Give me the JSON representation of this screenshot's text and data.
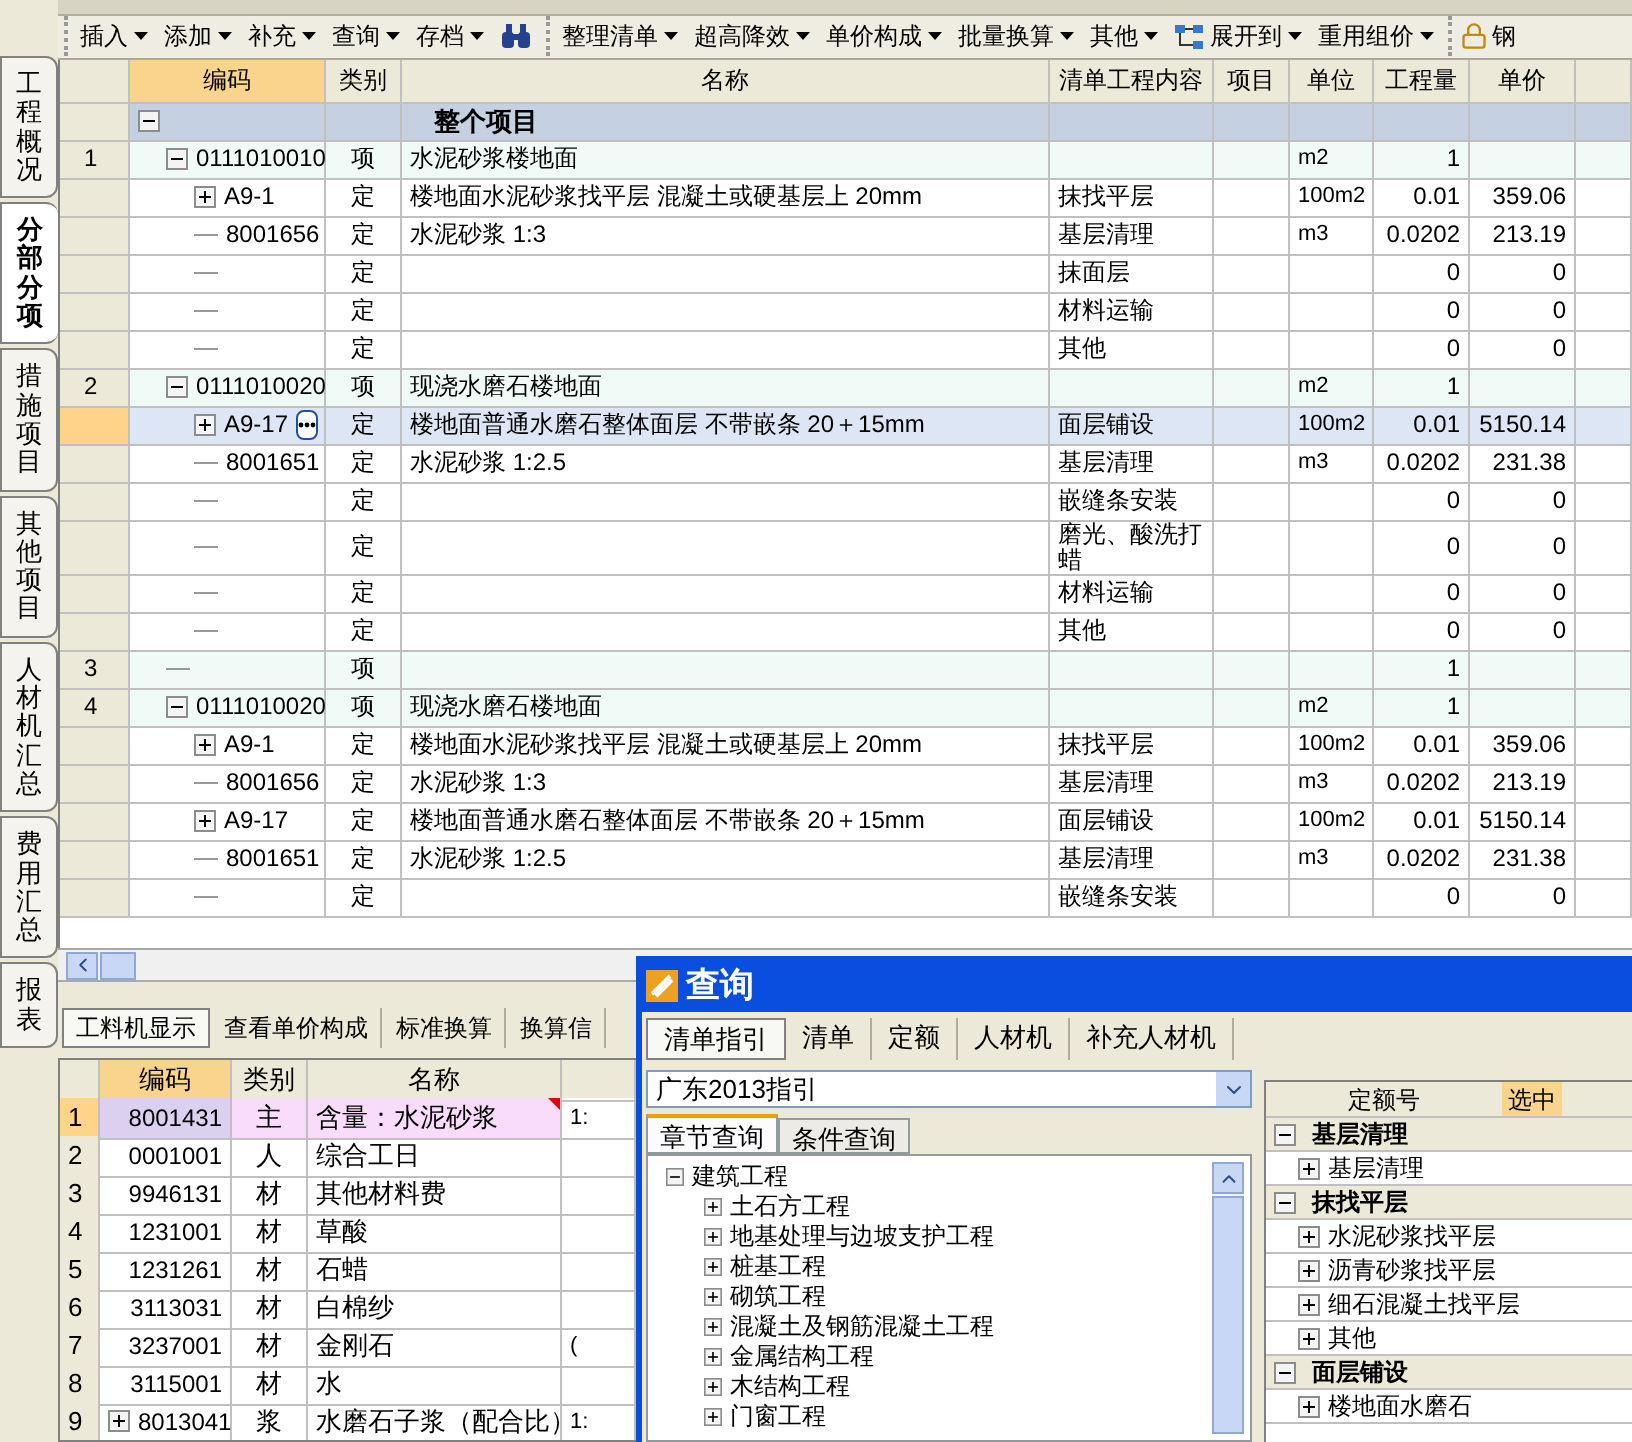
{
  "side_tabs": [
    {
      "label": "工程概况",
      "selected": false
    },
    {
      "label": "分部分项",
      "selected": true
    },
    {
      "label": "措施项目",
      "selected": false
    },
    {
      "label": "其他项目",
      "selected": false
    },
    {
      "label": "人材机汇总",
      "selected": false
    },
    {
      "label": "费用汇总",
      "selected": false
    },
    {
      "label": "报表",
      "selected": false
    }
  ],
  "toolbar": {
    "groups": [
      [
        {
          "kind": "menu",
          "label": "插入"
        },
        {
          "kind": "menu",
          "label": "添加"
        },
        {
          "kind": "menu",
          "label": "补充"
        },
        {
          "kind": "menu",
          "label": "查询"
        },
        {
          "kind": "menu",
          "label": "存档"
        },
        {
          "kind": "find"
        }
      ],
      [
        {
          "kind": "menu",
          "label": "整理清单"
        },
        {
          "kind": "menu",
          "label": "超高降效"
        },
        {
          "kind": "menu",
          "label": "单价构成"
        },
        {
          "kind": "menu",
          "label": "批量换算"
        },
        {
          "kind": "menu",
          "label": "其他"
        },
        {
          "kind": "tree-menu",
          "label": "展开到"
        },
        {
          "kind": "menu",
          "label": "重用组价"
        }
      ],
      [
        {
          "kind": "lock",
          "label": "钢"
        }
      ]
    ]
  },
  "table": {
    "columns": [
      "编码",
      "类别",
      "名称",
      "清单工程内容",
      "项目",
      "单位",
      "工程量",
      "单价"
    ],
    "rows": [
      {
        "code": "",
        "expanded": true,
        "name": "整个项目",
        "selected": false,
        "children": [
          {
            "num": "1",
            "code": "0111010010",
            "expanded": true,
            "type": "项",
            "name": "水泥砂浆楼地面",
            "unit": "m2",
            "qty": "1",
            "selected": false,
            "children": [
              {
                "code": "A9-1",
                "expanded": false,
                "type": "定",
                "name": "楼地面水泥砂浆找平层 混凝土或硬基层上 20mm",
                "content": "抹找平层",
                "unit": "100m2",
                "qty": "0.01",
                "price": "359.06",
                "selected": false
              },
              {
                "code": "8001656",
                "type": "定",
                "name": "水泥砂浆 1:3",
                "content": "基层清理",
                "unit": "m3",
                "qty": "0.0202",
                "price": "213.19",
                "selected": false
              },
              {
                "type": "定",
                "content": "抹面层",
                "qty": "0",
                "price": "0",
                "selected": false
              },
              {
                "type": "定",
                "content": "材料运输",
                "qty": "0",
                "price": "0",
                "selected": false
              },
              {
                "type": "定",
                "content": "其他",
                "qty": "0",
                "price": "0",
                "selected": false
              }
            ]
          },
          {
            "num": "2",
            "code": "0111010020",
            "expanded": true,
            "type": "项",
            "name": "现浇水磨石楼地面",
            "unit": "m2",
            "qty": "1",
            "selected": false,
            "children": [
              {
                "code": "A9-17",
                "expanded": false,
                "type": "定",
                "name": "楼地面普通水磨石整体面层 不带嵌条 20＋15mm",
                "content": "面层铺设",
                "unit": "100m2",
                "qty": "0.01",
                "price": "5150.14",
                "selected": true
              },
              {
                "code": "8001651",
                "type": "定",
                "name": "水泥砂浆 1:2.5",
                "content": "基层清理",
                "unit": "m3",
                "qty": "0.0202",
                "price": "231.38",
                "selected": false
              },
              {
                "type": "定",
                "content": "嵌缝条安装",
                "qty": "0",
                "price": "0",
                "selected": false
              },
              {
                "type": "定",
                "content": "磨光、酸洗打蜡",
                "qty": "0",
                "price": "0",
                "selected": false
              },
              {
                "type": "定",
                "content": "材料运输",
                "qty": "0",
                "price": "0",
                "selected": false
              },
              {
                "type": "定",
                "content": "其他",
                "qty": "0",
                "price": "0",
                "selected": false
              }
            ]
          },
          {
            "num": "3",
            "type": "项",
            "qty": "1",
            "selected": false
          },
          {
            "num": "4",
            "code": "0111010020",
            "expanded": true,
            "type": "项",
            "name": "现浇水磨石楼地面",
            "unit": "m2",
            "qty": "1",
            "selected": false,
            "children": [
              {
                "code": "A9-1",
                "expanded": false,
                "type": "定",
                "name": "楼地面水泥砂浆找平层 混凝土或硬基层上 20mm",
                "content": "抹找平层",
                "unit": "100m2",
                "qty": "0.01",
                "price": "359.06",
                "selected": false
              },
              {
                "code": "8001656",
                "type": "定",
                "name": "水泥砂浆 1:3",
                "content": "基层清理",
                "unit": "m3",
                "qty": "0.0202",
                "price": "213.19",
                "selected": false
              },
              {
                "code": "A9-17",
                "expanded": false,
                "type": "定",
                "name": "楼地面普通水磨石整体面层 不带嵌条 20＋15mm",
                "content": "面层铺设",
                "unit": "100m2",
                "qty": "0.01",
                "price": "5150.14",
                "selected": false
              },
              {
                "code": "8001651",
                "type": "定",
                "name": "水泥砂浆 1:2.5",
                "content": "基层清理",
                "unit": "m3",
                "qty": "0.0202",
                "price": "231.38",
                "selected": false
              },
              {
                "type": "定",
                "content": "嵌缝条安装",
                "qty": "0",
                "price": "0",
                "selected": false
              }
            ]
          }
        ]
      }
    ]
  },
  "bottom_panel": {
    "tabs": [
      {
        "label": "工料机显示",
        "selected": true
      },
      {
        "label": "查看单价构成",
        "selected": false
      },
      {
        "label": "标准换算",
        "selected": false
      },
      {
        "label": "换算信",
        "selected": false
      }
    ],
    "columns": [
      "编码",
      "类别",
      "名称"
    ],
    "rows": [
      {
        "num": "1",
        "code": "8001431",
        "type": "主",
        "name": "含量：水泥砂浆",
        "column_4": "1:",
        "selected": true,
        "flagged": true
      },
      {
        "num": "2",
        "code": "0001001",
        "type": "人",
        "name": "综合工日",
        "selected": false,
        "flagged": false
      },
      {
        "num": "3",
        "code": "9946131",
        "type": "材",
        "name": "其他材料费",
        "selected": false,
        "flagged": false
      },
      {
        "num": "4",
        "code": "1231001",
        "type": "材",
        "name": "草酸",
        "selected": false,
        "flagged": false
      },
      {
        "num": "5",
        "code": "1231261",
        "type": "材",
        "name": "石蜡",
        "selected": false,
        "flagged": false
      },
      {
        "num": "6",
        "code": "3113031",
        "type": "材",
        "name": "白棉纱",
        "selected": false,
        "flagged": false
      },
      {
        "num": "7",
        "code": "3237001",
        "type": "材",
        "name": "金刚石",
        "column_4": "(",
        "selected": false,
        "flagged": false
      },
      {
        "num": "8",
        "code": "3115001",
        "type": "材",
        "name": "水",
        "selected": false,
        "flagged": false
      },
      {
        "num": "9",
        "code": "8013041",
        "expanded": false,
        "type": "浆",
        "name": "水磨石子浆（配合比）",
        "column_4": "1:",
        "selected": false,
        "flagged": false
      }
    ]
  },
  "dialog": {
    "title": "查询",
    "tabs": [
      {
        "label": "清单指引",
        "selected": true
      },
      {
        "label": "清单",
        "selected": false
      },
      {
        "label": "定额",
        "selected": false
      },
      {
        "label": "人材机",
        "selected": false
      },
      {
        "label": "补充人材机",
        "selected": false
      }
    ],
    "dropdown": {
      "value": "广东2013指引"
    },
    "subtabs": [
      {
        "label": "章节查询",
        "selected": true
      },
      {
        "label": "条件查询",
        "selected": false
      }
    ],
    "tree": [
      {
        "label": "建筑工程",
        "expanded": true,
        "children": [
          {
            "label": "土石方工程",
            "expanded": false
          },
          {
            "label": "地基处理与边坡支护工程",
            "expanded": false
          },
          {
            "label": "桩基工程",
            "expanded": false
          },
          {
            "label": "砌筑工程",
            "expanded": false
          },
          {
            "label": "混凝土及钢筋混凝土工程",
            "expanded": false
          },
          {
            "label": "金属结构工程",
            "expanded": false
          },
          {
            "label": "木结构工程",
            "expanded": false
          },
          {
            "label": "门窗工程",
            "expanded": false
          }
        ]
      }
    ],
    "list": {
      "columns": [
        "定额号",
        "选中"
      ],
      "groups": [
        {
          "name": "基层清理",
          "expanded": true,
          "items": [
            {
              "name": "基层清理",
              "expanded": false
            }
          ]
        },
        {
          "name": "抹找平层",
          "expanded": true,
          "items": [
            {
              "name": "水泥砂浆找平层",
              "expanded": false
            },
            {
              "name": "沥青砂浆找平层",
              "expanded": false
            },
            {
              "name": "细石混凝土找平层",
              "expanded": false
            },
            {
              "name": "其他",
              "expanded": false
            }
          ]
        },
        {
          "name": "面层铺设",
          "expanded": true,
          "items": [
            {
              "name": "楼地面水磨石",
              "expanded": false
            }
          ]
        }
      ]
    }
  }
}
